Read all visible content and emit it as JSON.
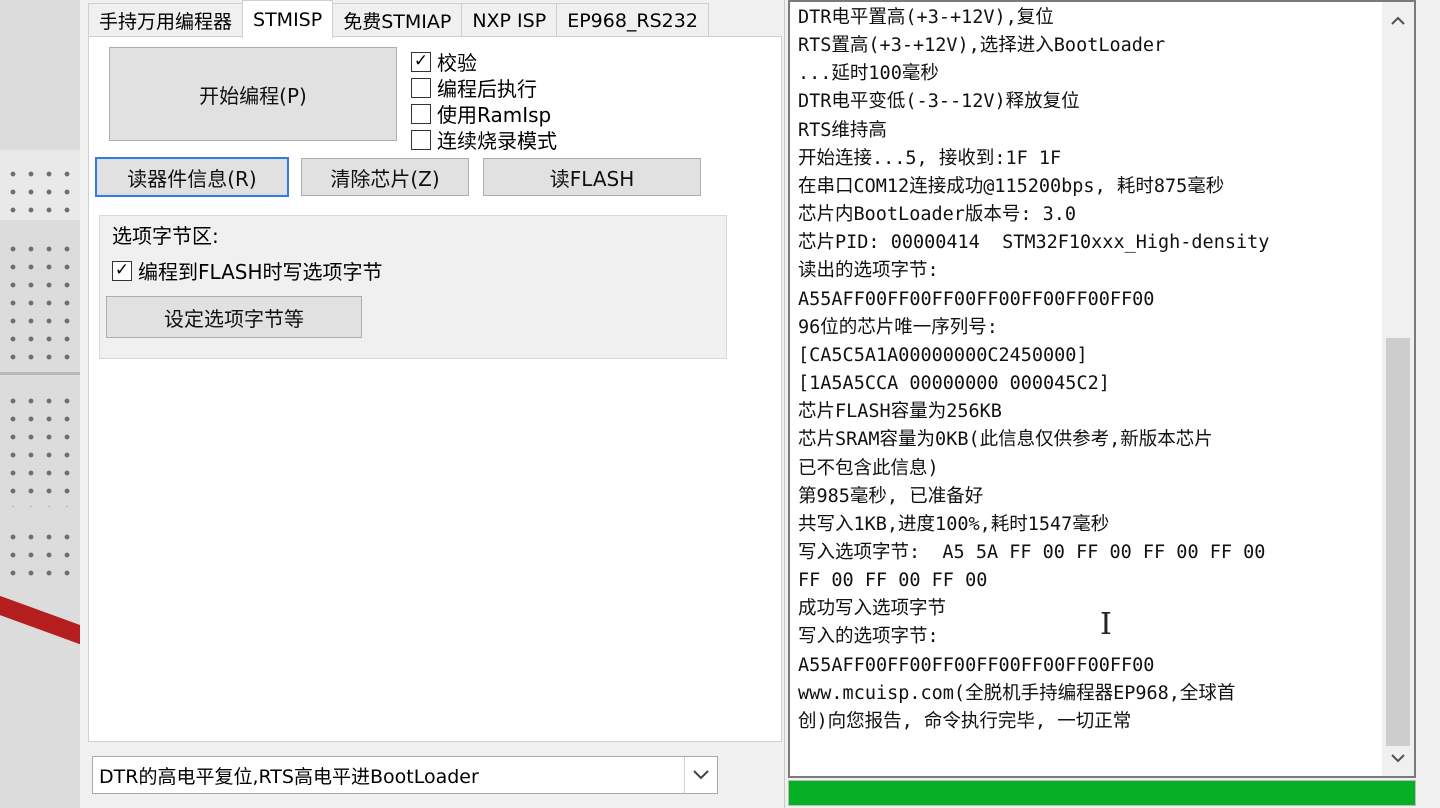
{
  "tabs": [
    {
      "label": "手持万用编程器"
    },
    {
      "label": "STMISP"
    },
    {
      "label": "免费STMIAP"
    },
    {
      "label": "NXP ISP"
    },
    {
      "label": "EP968_RS232"
    }
  ],
  "active_tab": "STMISP",
  "buttons": {
    "start_program": "开始编程(P)",
    "read_device_info": "读器件信息(R)",
    "erase_chip": "清除芯片(Z)",
    "read_flash": "读FLASH",
    "set_option_bytes": "设定选项字节等"
  },
  "checkboxes": [
    {
      "label": "校验",
      "checked": true
    },
    {
      "label": "编程后执行",
      "checked": false
    },
    {
      "label": "使用RamIsp",
      "checked": false
    },
    {
      "label": "连续烧录模式",
      "checked": false
    }
  ],
  "option_group": {
    "title": "选项字节区:",
    "checkbox": {
      "label": "编程到FLASH时写选项字节",
      "checked": true
    }
  },
  "mode_select": {
    "value": "DTR的高电平复位,RTS高电平进BootLoader"
  },
  "log_lines": [
    "DTR电平置高(+3-+12V),复位",
    "RTS置高(+3-+12V),选择进入BootLoader",
    "...延时100毫秒",
    "DTR电平变低(-3--12V)释放复位",
    "RTS维持高",
    "开始连接...5, 接收到:1F 1F",
    "在串口COM12连接成功@115200bps, 耗时875毫秒",
    "芯片内BootLoader版本号: 3.0",
    "芯片PID: 00000414  STM32F10xxx_High-density",
    "读出的选项字节:",
    "A55AFF00FF00FF00FF00FF00FF00FF00",
    "96位的芯片唯一序列号:",
    "[CA5C5A1A00000000C2450000]",
    "[1A5A5CCA 00000000 000045C2]",
    "芯片FLASH容量为256KB",
    "芯片SRAM容量为0KB(此信息仅供参考,新版本芯片",
    "已不包含此信息)",
    "第985毫秒, 已准备好",
    "共写入1KB,进度100%,耗时1547毫秒",
    "写入选项字节:  A5 5A FF 00 FF 00 FF 00 FF 00",
    "FF 00 FF 00 FF 00",
    "成功写入选项字节",
    "写入的选项字节:",
    "A55AFF00FF00FF00FF00FF00FF00FF00",
    "www.mcuisp.com(全脱机手持编程器EP968,全球首",
    "创)向您报告, 命令执行完毕, 一切正常"
  ],
  "progress": {
    "fraction": 1.0,
    "color": "#06b025"
  },
  "icons": {
    "check": "check-icon",
    "dropdown": "chevron-down-icon",
    "scroll_up": "scroll-up-arrow-icon",
    "scroll_down": "scroll-down-arrow-icon",
    "cursor": "text-cursor-icon"
  }
}
